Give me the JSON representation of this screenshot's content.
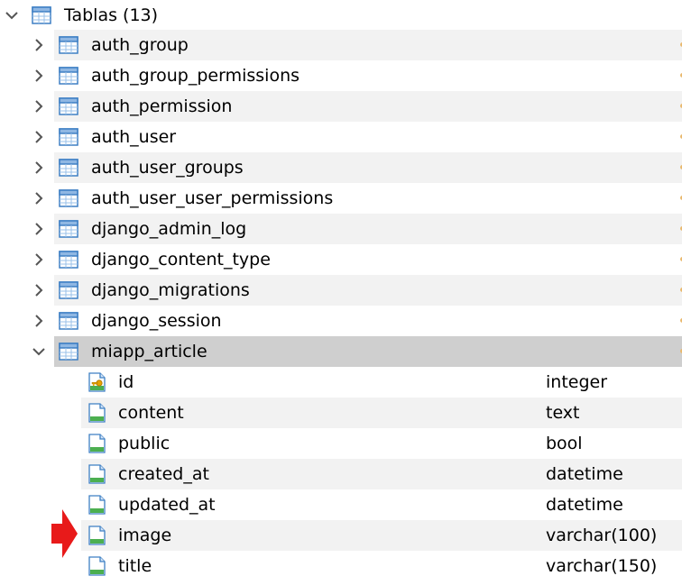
{
  "tree": {
    "root": {
      "label": "Tablas (13)",
      "expanded": true,
      "icon": "table-icon"
    },
    "tables": [
      {
        "name": "auth_group",
        "expanded": false
      },
      {
        "name": "auth_group_permissions",
        "expanded": false
      },
      {
        "name": "auth_permission",
        "expanded": false
      },
      {
        "name": "auth_user",
        "expanded": false
      },
      {
        "name": "auth_user_groups",
        "expanded": false
      },
      {
        "name": "auth_user_user_permissions",
        "expanded": false
      },
      {
        "name": "django_admin_log",
        "expanded": false
      },
      {
        "name": "django_content_type",
        "expanded": false
      },
      {
        "name": "django_migrations",
        "expanded": false
      },
      {
        "name": "django_session",
        "expanded": false
      },
      {
        "name": "miapp_article",
        "expanded": true,
        "selected": true,
        "columns": [
          {
            "name": "id",
            "type": "integer",
            "primary_key": true,
            "icon": "primary-key-column-icon"
          },
          {
            "name": "content",
            "type": "text",
            "icon": "column-icon"
          },
          {
            "name": "public",
            "type": "bool",
            "icon": "column-icon"
          },
          {
            "name": "created_at",
            "type": "datetime",
            "icon": "column-icon"
          },
          {
            "name": "updated_at",
            "type": "datetime",
            "icon": "column-icon"
          },
          {
            "name": "image",
            "type": "varchar(100)",
            "icon": "column-icon",
            "highlighted_by_arrow": true
          },
          {
            "name": "title",
            "type": "varchar(150)",
            "icon": "column-icon"
          }
        ]
      }
    ]
  },
  "colors": {
    "alt_row": "#f2f2f2",
    "selected_row": "#cfcfcf",
    "chevron": "#555555",
    "table_icon_blue": "#3d7fc4",
    "column_icon_green": "#4caf50",
    "key_gold": "#e8a200",
    "annotation_arrow": "#e81a1a"
  },
  "annotation": {
    "icon": "red-arrow-icon",
    "points_to": "image"
  }
}
